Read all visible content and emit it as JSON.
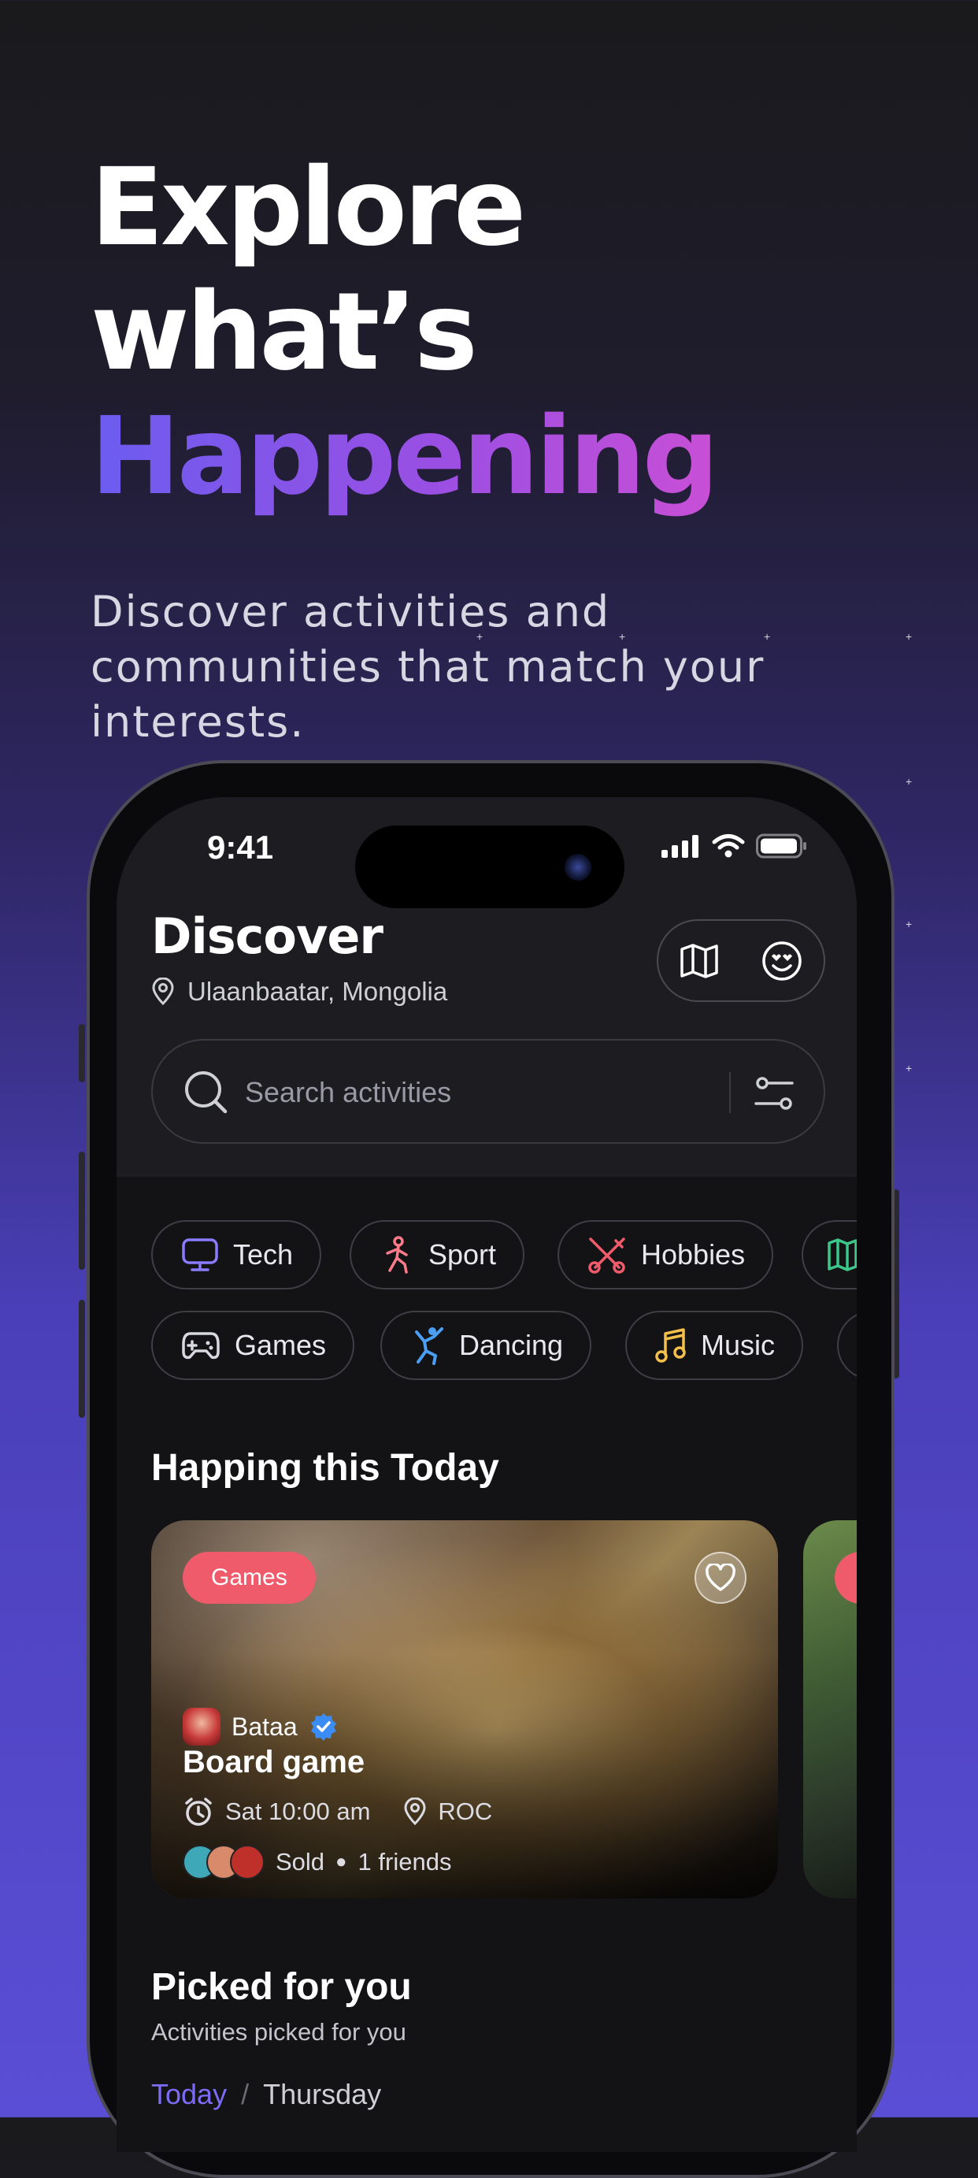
{
  "hero": {
    "line1": "Explore",
    "line2": "what’s",
    "line3": "Happening",
    "subtitle": "Discover activities and communities that match your interests."
  },
  "status_bar": {
    "time": "9:41"
  },
  "header": {
    "title": "Discover",
    "location": "Ulaanbaatar, Mongolia",
    "actions": [
      "map-icon",
      "smile-heart-eyes-icon"
    ]
  },
  "search": {
    "placeholder": "Search activities"
  },
  "categories": {
    "row1": [
      {
        "label": "Tech",
        "icon": "monitor-icon",
        "color": "#8b7bff"
      },
      {
        "label": "Sport",
        "icon": "running-person-icon",
        "color": "#ff7b8a"
      },
      {
        "label": "Hobbies",
        "icon": "crossed-tools-icon",
        "color": "#ef5b6b"
      },
      {
        "label": "",
        "icon": "map-icon",
        "color": "#3bc88a"
      }
    ],
    "row2": [
      {
        "label": "Games",
        "icon": "gamepad-icon",
        "color": "#d8d8e0"
      },
      {
        "label": "Dancing",
        "icon": "dancer-icon",
        "color": "#4a9ff5"
      },
      {
        "label": "Music",
        "icon": "music-note-icon",
        "color": "#f5c04a"
      }
    ]
  },
  "today": {
    "title": "Happing this Today",
    "cards": [
      {
        "tag": "Games",
        "host": "Bataa",
        "title": "Board game",
        "time": "Sat 10:00 am",
        "place": "ROC",
        "status": "Sold",
        "friends": "1 friends"
      }
    ]
  },
  "picked": {
    "title": "Picked for you",
    "subtitle": "Activities picked for you",
    "tab_today": "Today",
    "tab_separator": "/",
    "tab_day": "Thursday"
  },
  "colors": {
    "accent": "#7b6cf5",
    "tag": "#ef5b6b",
    "background_top": "#1a1a1c",
    "background_bottom": "#5a4ed6"
  }
}
